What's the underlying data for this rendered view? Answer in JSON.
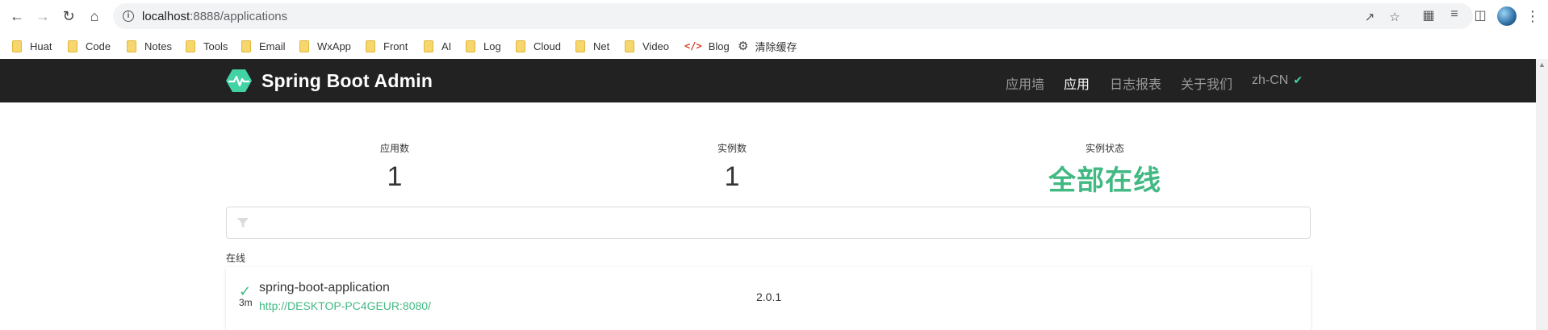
{
  "browser": {
    "url_host": "localhost",
    "url_path": ":8888/applications"
  },
  "bookmarks": [
    {
      "label": "Huat",
      "icon": "folder-icon"
    },
    {
      "label": "Code",
      "icon": "folder-icon"
    },
    {
      "label": "Notes",
      "icon": "folder-icon"
    },
    {
      "label": "Tools",
      "icon": "folder-icon"
    },
    {
      "label": "Email",
      "icon": "folder-icon"
    },
    {
      "label": "WxApp",
      "icon": "folder-icon"
    },
    {
      "label": "Front",
      "icon": "folder-icon"
    },
    {
      "label": "AI",
      "icon": "folder-icon"
    },
    {
      "label": "Log",
      "icon": "folder-icon"
    },
    {
      "label": "Cloud",
      "icon": "folder-icon"
    },
    {
      "label": "Net",
      "icon": "folder-icon"
    },
    {
      "label": "Video",
      "icon": "folder-icon"
    },
    {
      "label": "Blog",
      "icon": "code-icon"
    },
    {
      "label": "清除缓存",
      "icon": "gear-icon"
    }
  ],
  "navbar": {
    "brand": "Spring Boot Admin",
    "links": [
      "应用墙",
      "应用",
      "日志报表",
      "关于我们"
    ],
    "active": "应用",
    "language": "zh-CN"
  },
  "stats": {
    "apps_label": "应用数",
    "apps_value": "1",
    "instances_label": "实例数",
    "instances_value": "1",
    "status_label": "实例状态",
    "status_value": "全部在线"
  },
  "filter": {
    "placeholder": ""
  },
  "group": {
    "label": "在线"
  },
  "application": {
    "name": "spring-boot-application",
    "uptime": "3m",
    "url": "http://DESKTOP-PC4GEUR:8080/",
    "version": "2.0.1"
  },
  "colors": {
    "accent": "#42b983",
    "navbar_bg": "#222222"
  }
}
